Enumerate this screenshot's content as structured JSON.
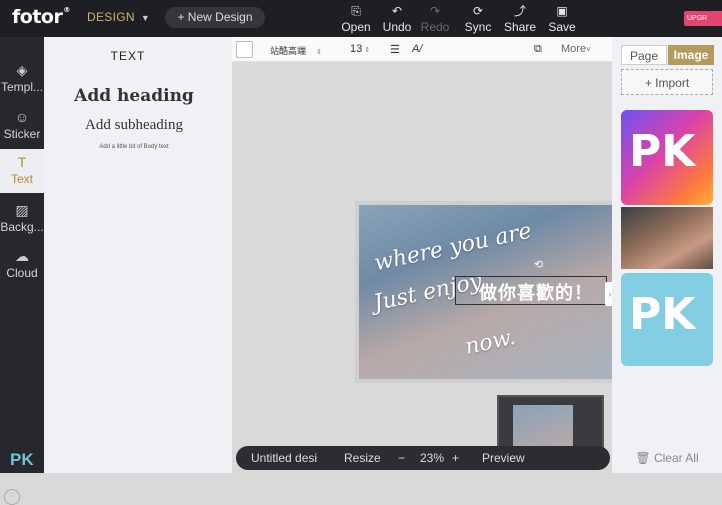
{
  "topbar": {
    "logo": "fotor",
    "logo_mark": "®",
    "design_menu": "DESIGN",
    "new_design": "+ New Design",
    "buttons": [
      {
        "label": "Open",
        "icon": "open-icon",
        "glyph": "⎘",
        "enabled": true
      },
      {
        "label": "Undo",
        "icon": "undo-icon",
        "glyph": "↶",
        "enabled": true
      },
      {
        "label": "Redo",
        "icon": "redo-icon",
        "glyph": "↷",
        "enabled": false
      },
      {
        "label": "Sync",
        "icon": "sync-icon",
        "glyph": "⟳",
        "enabled": true
      },
      {
        "label": "Share",
        "icon": "share-icon",
        "glyph": "⤴",
        "enabled": true
      },
      {
        "label": "Save",
        "icon": "save-icon",
        "glyph": "▣",
        "enabled": true
      }
    ],
    "upgrade": "UPGR",
    "upgrade_color": "#e4456f"
  },
  "leftrail": {
    "items": [
      {
        "label": "Templ...",
        "icon": "layers-icon",
        "glyph": "◈",
        "active": false
      },
      {
        "label": "Sticker",
        "icon": "sticker-icon",
        "glyph": "☺",
        "active": false
      },
      {
        "label": "Text",
        "icon": "text-icon",
        "glyph": "T",
        "active": true
      },
      {
        "label": "Backg...",
        "icon": "background-icon",
        "glyph": "▨",
        "active": false
      },
      {
        "label": "Cloud",
        "icon": "cloud-icon",
        "glyph": "☁",
        "active": false
      }
    ],
    "active_color": "#b88a2e"
  },
  "textpanel": {
    "title": "TEXT",
    "heading": "Add heading",
    "subheading": "Add subheading",
    "body": "Add a little bit of Body text"
  },
  "props": {
    "font": "站酷高端",
    "size": "13",
    "more": "More"
  },
  "canvas": {
    "line1": "where you are",
    "line2": "Just enjoy",
    "line3": "now.",
    "chinese": "做你喜歡的！"
  },
  "bottombar": {
    "doc_name": "Untitled desi",
    "resize": "Resize",
    "zoom_minus": "−",
    "zoom": "23%",
    "zoom_plus": "+",
    "preview": "Preview"
  },
  "rightpanel": {
    "tab_page": "Page",
    "tab_image": "Image",
    "import": "+ Import",
    "clear_all": "Clear All",
    "pk_text": "PK",
    "tab_active_color": "#b59a5e"
  }
}
